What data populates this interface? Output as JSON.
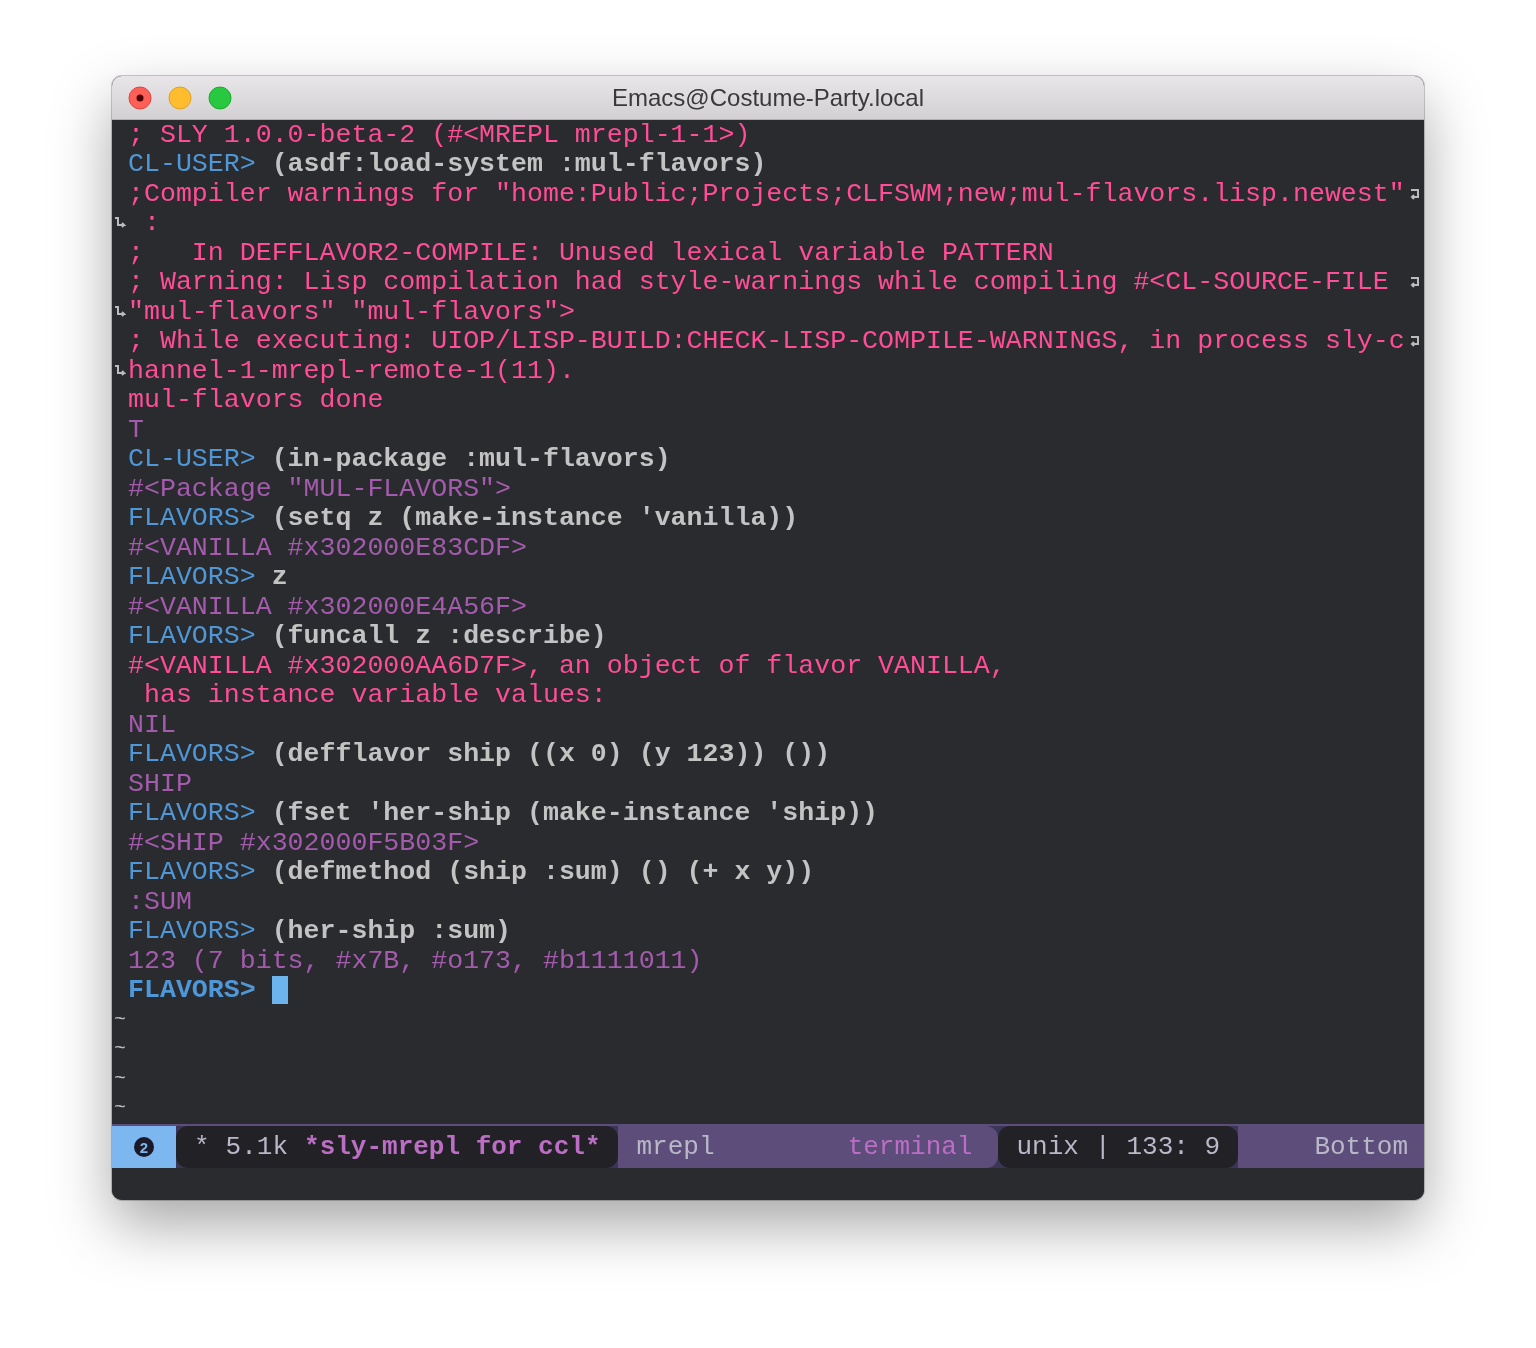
{
  "window": {
    "title": "Emacs@Costume-Party.local"
  },
  "lines": [
    {
      "wrap_start": false,
      "wrap_end": false,
      "active": false,
      "segments": [
        {
          "kind": "output",
          "text": "; SLY 1.0.0-beta-2 (#<MREPL mrepl-1-1>)"
        }
      ]
    },
    {
      "wrap_start": false,
      "wrap_end": false,
      "active": false,
      "segments": [
        {
          "kind": "prompt",
          "text": "CL-USER>"
        },
        {
          "kind": "input",
          "text": "(asdf:load-system :mul-flavors)"
        }
      ]
    },
    {
      "wrap_start": false,
      "wrap_end": true,
      "active": false,
      "segments": [
        {
          "kind": "output",
          "text": ";Compiler warnings for \"home:Public;Projects;CLFSWM;new;mul-flavors.lisp.newest\""
        }
      ]
    },
    {
      "wrap_start": true,
      "wrap_end": false,
      "active": false,
      "segments": [
        {
          "kind": "output",
          "text": " :"
        }
      ]
    },
    {
      "wrap_start": false,
      "wrap_end": false,
      "active": false,
      "segments": [
        {
          "kind": "output",
          "text": ";   In DEFFLAVOR2-COMPILE: Unused lexical variable PATTERN"
        }
      ]
    },
    {
      "wrap_start": false,
      "wrap_end": true,
      "active": false,
      "segments": [
        {
          "kind": "output",
          "text": "; Warning: Lisp compilation had style-warnings while compiling #<CL-SOURCE-FILE"
        }
      ]
    },
    {
      "wrap_start": true,
      "wrap_end": false,
      "active": false,
      "segments": [
        {
          "kind": "output",
          "text": "\"mul-flavors\" \"mul-flavors\">"
        }
      ]
    },
    {
      "wrap_start": false,
      "wrap_end": true,
      "active": false,
      "segments": [
        {
          "kind": "output",
          "text": "; While executing: UIOP/LISP-BUILD:CHECK-LISP-COMPILE-WARNINGS, in process sly-c"
        }
      ]
    },
    {
      "wrap_start": true,
      "wrap_end": false,
      "active": false,
      "segments": [
        {
          "kind": "output",
          "text": "hannel-1-mrepl-remote-1(11)."
        }
      ]
    },
    {
      "wrap_start": false,
      "wrap_end": false,
      "active": false,
      "segments": [
        {
          "kind": "output",
          "text": "mul-flavors done"
        }
      ]
    },
    {
      "wrap_start": false,
      "wrap_end": false,
      "active": false,
      "segments": [
        {
          "kind": "result",
          "text": "T"
        }
      ]
    },
    {
      "wrap_start": false,
      "wrap_end": false,
      "active": false,
      "segments": [
        {
          "kind": "prompt",
          "text": "CL-USER>"
        },
        {
          "kind": "input",
          "text": "(in-package :mul-flavors)"
        }
      ]
    },
    {
      "wrap_start": false,
      "wrap_end": false,
      "active": false,
      "segments": [
        {
          "kind": "result",
          "text": "#<Package \"MUL-FLAVORS\">"
        }
      ]
    },
    {
      "wrap_start": false,
      "wrap_end": false,
      "active": false,
      "segments": [
        {
          "kind": "prompt",
          "text": "FLAVORS>"
        },
        {
          "kind": "input",
          "text": "(setq z (make-instance 'vanilla))"
        }
      ]
    },
    {
      "wrap_start": false,
      "wrap_end": false,
      "active": false,
      "segments": [
        {
          "kind": "result",
          "text": "#<VANILLA #x302000E83CDF>"
        }
      ]
    },
    {
      "wrap_start": false,
      "wrap_end": false,
      "active": false,
      "segments": [
        {
          "kind": "prompt",
          "text": "FLAVORS>"
        },
        {
          "kind": "input",
          "text": "z"
        }
      ]
    },
    {
      "wrap_start": false,
      "wrap_end": false,
      "active": false,
      "segments": [
        {
          "kind": "result",
          "text": "#<VANILLA #x302000E4A56F>"
        }
      ]
    },
    {
      "wrap_start": false,
      "wrap_end": false,
      "active": false,
      "segments": [
        {
          "kind": "prompt",
          "text": "FLAVORS>"
        },
        {
          "kind": "input",
          "text": "(funcall z :describe)"
        }
      ]
    },
    {
      "wrap_start": false,
      "wrap_end": false,
      "active": false,
      "segments": [
        {
          "kind": "output",
          "text": "#<VANILLA #x302000AA6D7F>, an object of flavor VANILLA,"
        }
      ]
    },
    {
      "wrap_start": false,
      "wrap_end": false,
      "active": false,
      "segments": [
        {
          "kind": "output",
          "text": " has instance variable values:"
        }
      ]
    },
    {
      "wrap_start": false,
      "wrap_end": false,
      "active": false,
      "segments": [
        {
          "kind": "result",
          "text": "NIL"
        }
      ]
    },
    {
      "wrap_start": false,
      "wrap_end": false,
      "active": false,
      "segments": [
        {
          "kind": "prompt",
          "text": "FLAVORS>"
        },
        {
          "kind": "input",
          "text": "(defflavor ship ((x 0) (y 123)) ())"
        }
      ]
    },
    {
      "wrap_start": false,
      "wrap_end": false,
      "active": false,
      "segments": [
        {
          "kind": "result",
          "text": "SHIP"
        }
      ]
    },
    {
      "wrap_start": false,
      "wrap_end": false,
      "active": false,
      "segments": [
        {
          "kind": "prompt",
          "text": "FLAVORS>"
        },
        {
          "kind": "input",
          "text": "(fset 'her-ship (make-instance 'ship))"
        }
      ]
    },
    {
      "wrap_start": false,
      "wrap_end": false,
      "active": false,
      "segments": [
        {
          "kind": "result",
          "text": "#<SHIP #x302000F5B03F>"
        }
      ]
    },
    {
      "wrap_start": false,
      "wrap_end": false,
      "active": false,
      "segments": [
        {
          "kind": "prompt",
          "text": "FLAVORS>"
        },
        {
          "kind": "input",
          "text": "(defmethod (ship :sum) () (+ x y))"
        }
      ]
    },
    {
      "wrap_start": false,
      "wrap_end": false,
      "active": false,
      "segments": [
        {
          "kind": "result",
          "text": ":SUM"
        }
      ]
    },
    {
      "wrap_start": false,
      "wrap_end": false,
      "active": false,
      "segments": [
        {
          "kind": "prompt",
          "text": "FLAVORS>"
        },
        {
          "kind": "input",
          "text": "(her-ship :sum)"
        }
      ]
    },
    {
      "wrap_start": false,
      "wrap_end": false,
      "active": false,
      "segments": [
        {
          "kind": "result",
          "text": "123 (7 bits, #x7B, #o173, #b1111011)"
        }
      ]
    },
    {
      "wrap_start": false,
      "wrap_end": false,
      "active": true,
      "segments": [
        {
          "kind": "prompt",
          "text": "FLAVORS>"
        }
      ]
    }
  ],
  "empty_line_marks": [
    "~",
    "~",
    "~",
    "~"
  ],
  "mode_line": {
    "window_number": "2",
    "modified": "*",
    "size": "5.1k",
    "buffer_name": "*sly-mrepl for ccl*",
    "major_mode": "mrepl",
    "minor_mode": "terminal",
    "encoding": "unix",
    "separator": "|",
    "position": "133: 9",
    "scroll": "Bottom"
  }
}
